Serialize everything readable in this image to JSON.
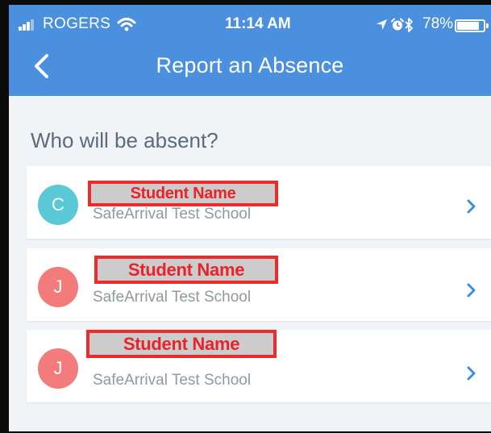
{
  "status_bar": {
    "carrier": "ROGERS",
    "time": "11:14 AM",
    "battery_percent": "78%",
    "battery_level": 0.78,
    "icons": [
      "signal-icon",
      "wifi-icon",
      "location-arrow-icon",
      "alarm-icon",
      "bluetooth-icon",
      "battery-icon"
    ]
  },
  "nav": {
    "title": "Report an Absence",
    "back_icon": "chevron-left-icon"
  },
  "prompt": "Who will be absent?",
  "students": [
    {
      "initial": "C",
      "name": "Student Name",
      "school": "SafeArrival Test School",
      "avatar_color": "#5bc8d6"
    },
    {
      "initial": "J",
      "name": "Student Name",
      "school": "SafeArrival Test School",
      "avatar_color": "#f47b7b"
    },
    {
      "initial": "J",
      "name": "Student Name",
      "school": "SafeArrival Test School",
      "avatar_color": "#f47b7b"
    }
  ],
  "colors": {
    "header": "#4a90de",
    "background": "#f1f4f7",
    "chevron": "#3d8fe0",
    "redaction_border": "#ee2a2a"
  }
}
